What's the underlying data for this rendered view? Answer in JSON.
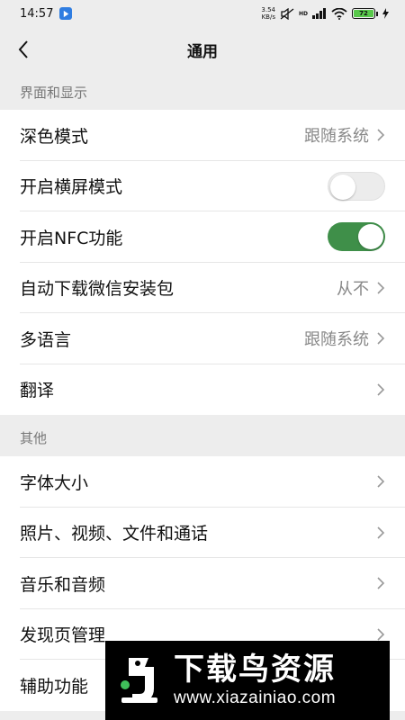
{
  "status_bar": {
    "time": "14:57",
    "net_speed_value": "3.54",
    "net_speed_unit": "KB/s",
    "signal_tag": "HD",
    "battery": "72"
  },
  "nav": {
    "title": "通用"
  },
  "sections": [
    {
      "header": "界面和显示",
      "items": [
        {
          "label": "深色模式",
          "value": "跟随系统"
        },
        {
          "label": "开启横屏模式"
        },
        {
          "label": "开启NFC功能"
        },
        {
          "label": "自动下载微信安装包",
          "value": "从不"
        },
        {
          "label": "多语言",
          "value": "跟随系统"
        },
        {
          "label": "翻译"
        }
      ]
    },
    {
      "header": "其他",
      "items": [
        {
          "label": "字体大小"
        },
        {
          "label": "照片、视频、文件和通话"
        },
        {
          "label": "音乐和音频"
        },
        {
          "label": "发现页管理"
        },
        {
          "label": "辅助功能"
        }
      ]
    }
  ],
  "toggles": {
    "landscape_on": false,
    "nfc_on": true
  },
  "colors": {
    "toggle_on": "#3f8f49",
    "toggle_off": "#ececec",
    "background": "#ededed"
  },
  "watermark": {
    "name": "下载鸟资源",
    "url": "www.xiazainiao.com"
  }
}
